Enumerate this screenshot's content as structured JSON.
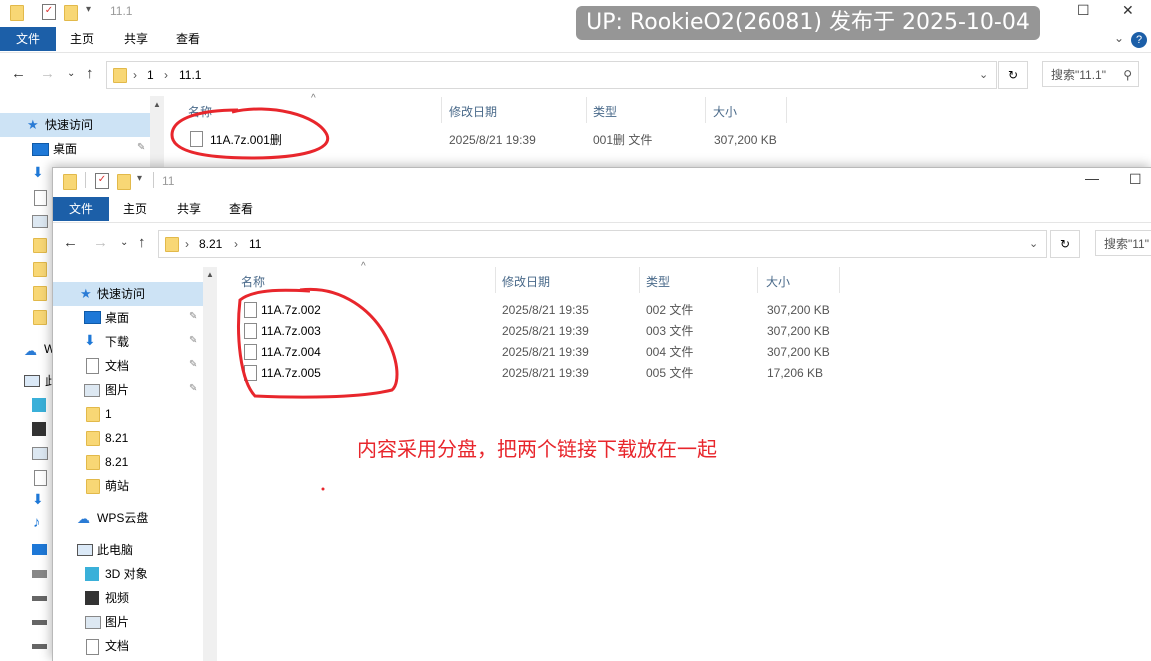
{
  "watermark": "UP: RookieO2(26081) 发布于 2025-10-04",
  "annotation": "内容采用分盘，把两个链接下载放在一起",
  "back_window": {
    "title": "11.1",
    "tabs": [
      "文件",
      "主页",
      "共享",
      "查看"
    ],
    "breadcrumb": [
      "1",
      "11.1"
    ],
    "search_placeholder": "搜索\"11.1\"",
    "columns": [
      "名称",
      "修改日期",
      "类型",
      "大小"
    ],
    "files": [
      {
        "name": "11A.7z.001删",
        "date": "2025/8/21 19:39",
        "type": "001删 文件",
        "size": "307,200 KB"
      }
    ],
    "nav": {
      "quick_access": "快速访问",
      "desktop": "桌面",
      "wps_partial": "W",
      "pc_partial": "此"
    }
  },
  "front_window": {
    "title": "11",
    "tabs": [
      "文件",
      "主页",
      "共享",
      "查看"
    ],
    "breadcrumb": [
      "8.21",
      "11"
    ],
    "search_placeholder": "搜索\"11\"",
    "columns": [
      "名称",
      "修改日期",
      "类型",
      "大小"
    ],
    "files": [
      {
        "name": "11A.7z.002",
        "date": "2025/8/21 19:35",
        "type": "002 文件",
        "size": "307,200 KB"
      },
      {
        "name": "11A.7z.003",
        "date": "2025/8/21 19:39",
        "type": "003 文件",
        "size": "307,200 KB"
      },
      {
        "name": "11A.7z.004",
        "date": "2025/8/21 19:39",
        "type": "004 文件",
        "size": "307,200 KB"
      },
      {
        "name": "11A.7z.005",
        "date": "2025/8/21 19:39",
        "type": "005 文件",
        "size": "17,206 KB"
      }
    ],
    "nav": {
      "quick_access": "快速访问",
      "pinned": [
        "桌面",
        "下载",
        "文档",
        "图片"
      ],
      "folders": [
        "1",
        "8.21",
        "8.21",
        "萌站"
      ],
      "wps": "WPS云盘",
      "this_pc": "此电脑",
      "pc_items": [
        "3D 对象",
        "视频",
        "图片",
        "文档"
      ]
    }
  },
  "colors": {
    "accent": "#1c5fa8",
    "annotation": "#e8262c",
    "folder": "#f8d775"
  }
}
